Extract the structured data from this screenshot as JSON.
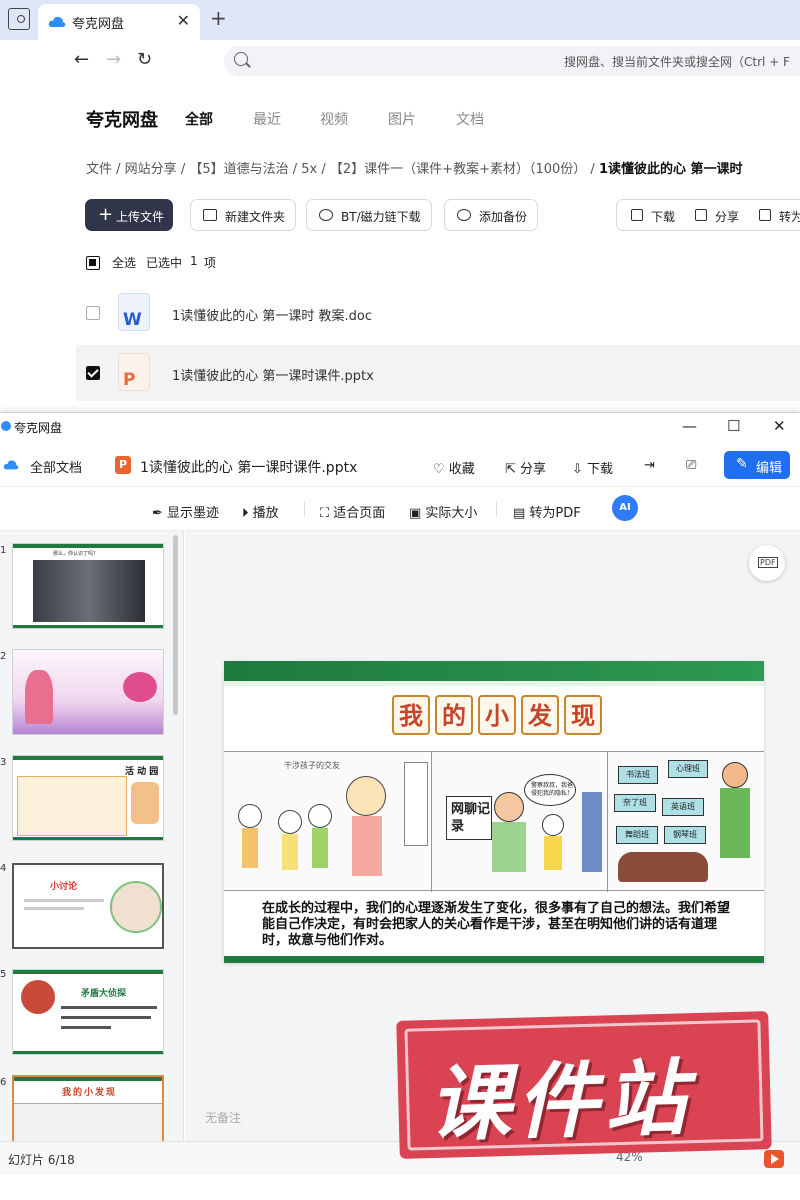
{
  "browser": {
    "tab_title": "夸克网盘",
    "address_placeholder": "搜网盘、搜当前文件夹或搜全网（Ctrl + F"
  },
  "drive": {
    "brand": "夸克网盘",
    "tabs": [
      "全部",
      "最近",
      "视频",
      "图片",
      "文档"
    ],
    "breadcrumb": [
      "文件",
      "网站分享",
      "【5】道德与法治",
      "5x",
      "【2】课件一（课件+教案+素材）（100份）",
      "1读懂彼此的心 第一课时"
    ],
    "toolbar": {
      "upload": "上传文件",
      "new_folder": "新建文件夹",
      "bt": "BT/磁力链下载",
      "backup": "添加备份",
      "download": "下载",
      "share": "分享",
      "to_pdf": "转为"
    },
    "selection": {
      "select_all": "全选",
      "selected_prefix": "已选中",
      "count": "1",
      "unit": "项"
    },
    "files": [
      {
        "name": "1读懂彼此的心  第一课时 教案.doc",
        "type": "doc",
        "icon_letter": "W",
        "checked": false
      },
      {
        "name": "1读懂彼此的心  第一课时课件.pptx",
        "type": "ppt",
        "icon_letter": "P",
        "checked": true
      }
    ]
  },
  "viewer": {
    "app_name": "夸克网盘",
    "all_docs": "全部文档",
    "file_icon_letter": "P",
    "file_name": "1读懂彼此的心 第一课时课件.pptx",
    "actions": {
      "favorite": "收藏",
      "share": "分享",
      "download": "下载",
      "edit": "编辑"
    },
    "toolbar": {
      "ink": "显示墨迹",
      "play": "播放",
      "fit_page": "适合页面",
      "actual_size": "实际大小",
      "to_pdf": "转为PDF",
      "ai": "AI"
    },
    "thumbs": [
      {
        "num": "1",
        "text": "那么，你认识了吗？"
      },
      {
        "num": "2",
        "text": ""
      },
      {
        "num": "3",
        "text": "活 动 园"
      },
      {
        "num": "4",
        "text": "小讨论"
      },
      {
        "num": "5",
        "text": "矛盾大侦探"
      },
      {
        "num": "6",
        "text": "我的小发现"
      }
    ],
    "slide": {
      "title_chars": [
        "我",
        "的",
        "小",
        "发",
        "现"
      ],
      "panel1_label": "干涉孩子的交友",
      "panel2_label": "网聊记录",
      "panel2_bubble": "警察叔叔，我爸侵犯我的隐私！",
      "panel3_labels": [
        "书法班",
        "心理班",
        "奈了班",
        "英语班",
        "舞蹈班",
        "钢琴班"
      ],
      "caption": "在成长的过程中，我们的心理逐渐发生了变化，很多事有了自己的想法。我们希望能自己作决定，有时会把家人的关心看作是干涉，甚至在明知他们讲的话有道理时，故意与他们作对。"
    },
    "notes": "无备注",
    "status": {
      "page": "幻灯片 6/18",
      "zoom": "42%"
    }
  },
  "watermark": "课件站",
  "colors": {
    "accent_blue": "#1f6ff2",
    "slide_green": "#1e7a3f",
    "ppt_orange": "#e9642f",
    "watermark_red": "#d83a4a"
  }
}
